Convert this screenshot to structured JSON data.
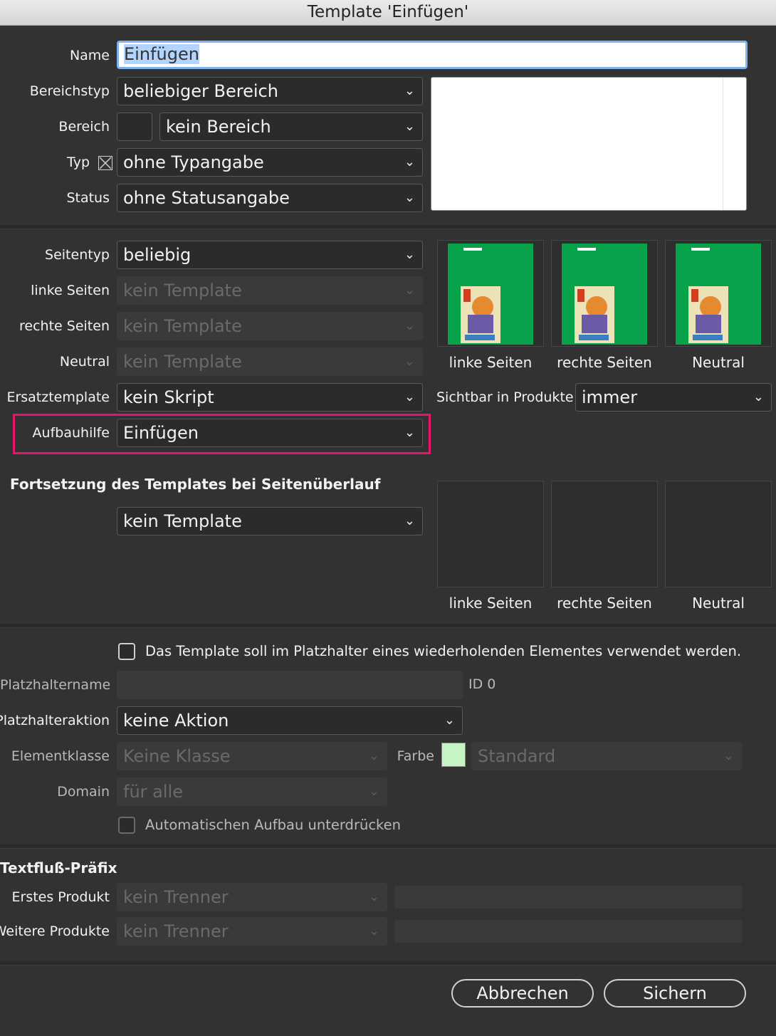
{
  "window": {
    "title": "Template 'Einfügen'"
  },
  "top": {
    "name_label": "Name",
    "name_value": "Einfügen",
    "bereichstyp_label": "Bereichstyp",
    "bereichstyp_value": "beliebiger Bereich",
    "bereich_label": "Bereich",
    "bereich_value": "kein Bereich",
    "typ_label": "Typ",
    "typ_value": "ohne Typangabe",
    "status_label": "Status",
    "status_value": "ohne Statusangabe"
  },
  "pages": {
    "seitentyp_label": "Seitentyp",
    "seitentyp_value": "beliebig",
    "linke_label": "linke Seiten",
    "linke_value": "kein Template",
    "rechte_label": "rechte Seiten",
    "rechte_value": "kein Template",
    "neutral_label": "Neutral",
    "neutral_value": "kein Template",
    "ersatz_label": "Ersatztemplate",
    "ersatz_value": "kein Skript",
    "aufbau_label": "Aufbauhilfe",
    "aufbau_value": "Einfügen",
    "sichtbar_label": "Sichtbar in Produkte",
    "sichtbar_value": "immer",
    "thumb_captions": [
      "linke Seiten",
      "rechte Seiten",
      "Neutral"
    ],
    "highlight_color": "#e8136f"
  },
  "overflow": {
    "heading": "Fortsetzung des Templates bei Seitenüberlauf",
    "template_value": "kein Template",
    "thumb_captions": [
      "linke Seiten",
      "rechte Seiten",
      "Neutral"
    ]
  },
  "placeholder": {
    "checkbox_label": "Das Template soll im Platzhalter eines wiederholenden Elementes verwendet werden.",
    "name_label": "Platzhaltername",
    "id_text": "ID 0",
    "aktion_label": "Platzhalteraktion",
    "aktion_value": "keine Aktion",
    "klasse_label": "Elementklasse",
    "klasse_value": "Keine Klasse",
    "farbe_label": "Farbe",
    "farbe_value": "Standard",
    "farbe_swatch": "#c6f5c4",
    "domain_label": "Domain",
    "domain_value": "für alle",
    "auto_label": "Automatischen Aufbau unterdrücken"
  },
  "textflow": {
    "heading": "Textfluß-Präfix",
    "erstes_label": "Erstes Produkt",
    "erstes_value": "kein Trenner",
    "weitere_label": "Weitere Produkte",
    "weitere_value": "kein Trenner"
  },
  "buttons": {
    "cancel": "Abbrechen",
    "save": "Sichern"
  }
}
